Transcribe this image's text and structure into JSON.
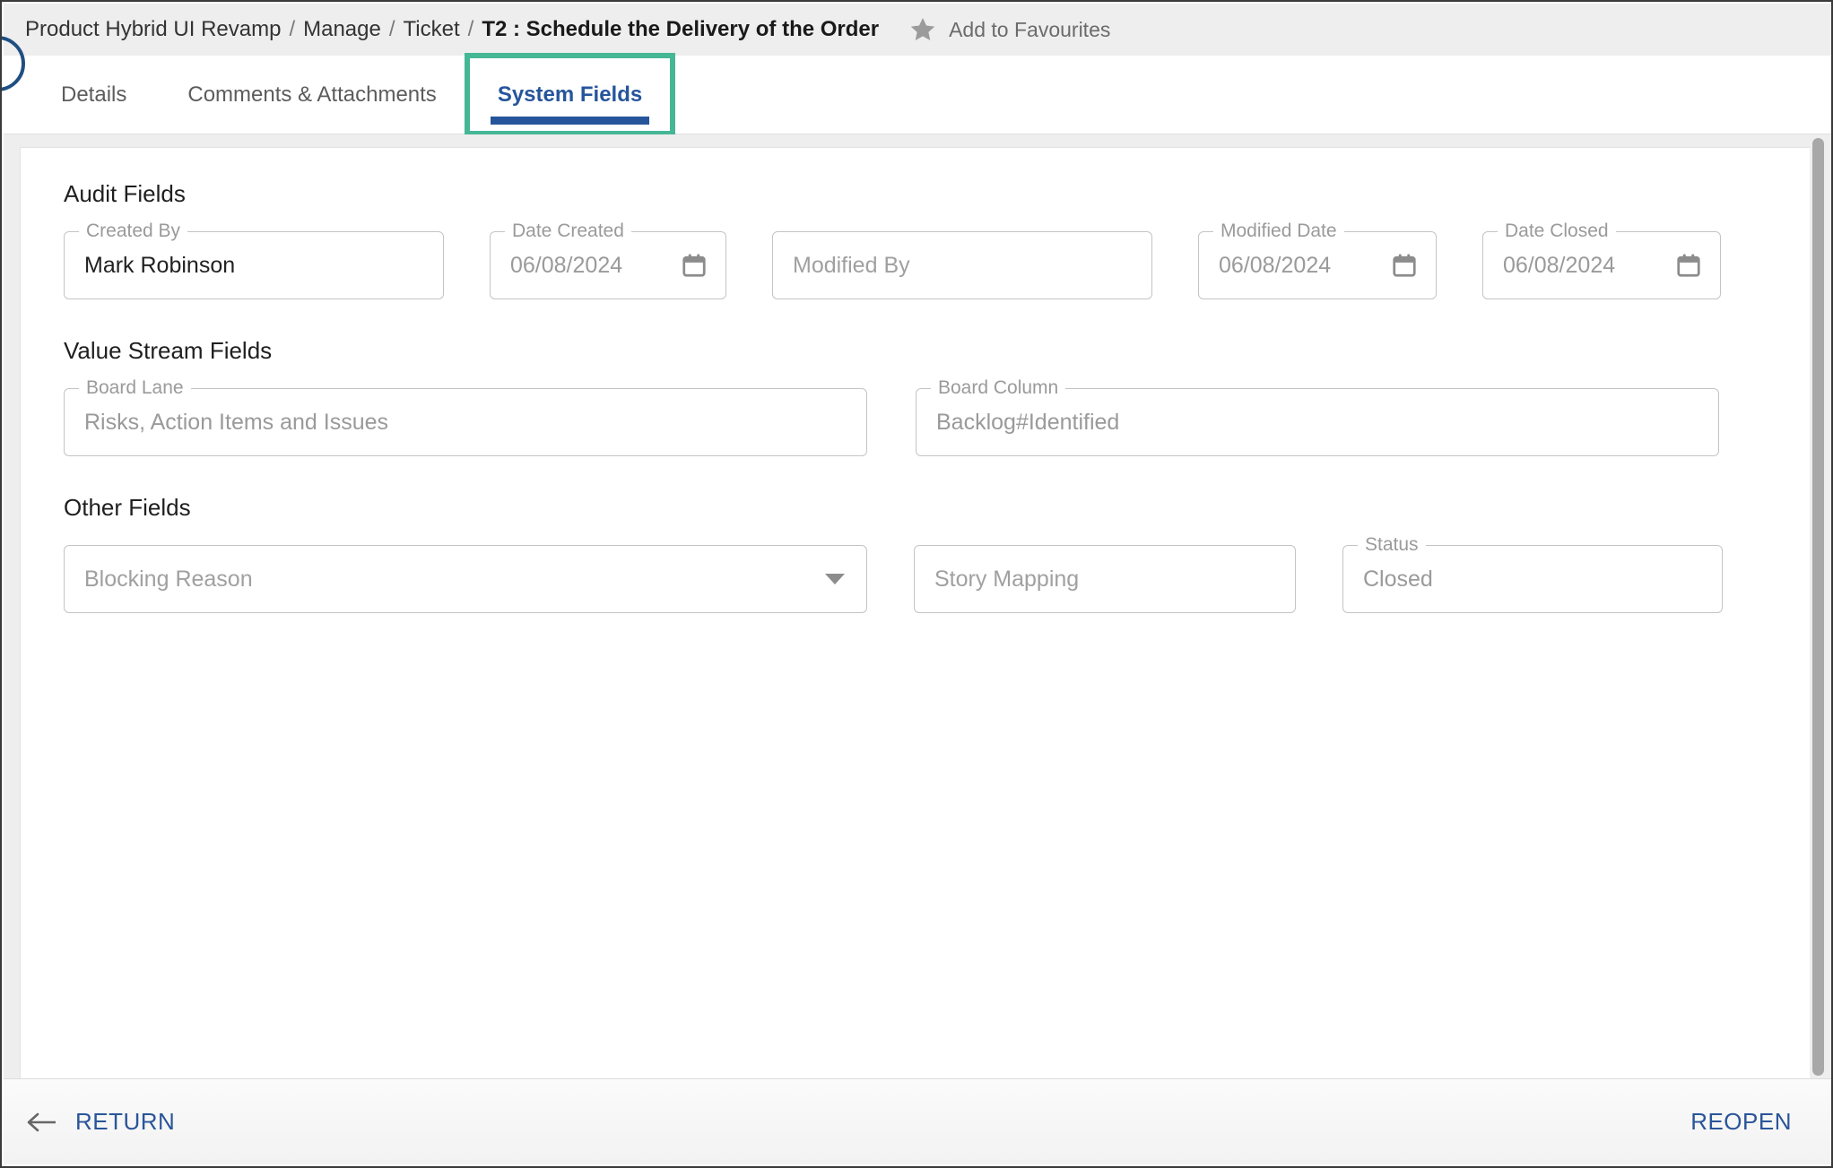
{
  "breadcrumb": {
    "items": [
      "Product Hybrid UI Revamp",
      "Manage",
      "Ticket"
    ],
    "separator": "/",
    "current": "T2 : Schedule the Delivery of the Order",
    "favourite_label": "Add to Favourites",
    "star_icon": "star-icon"
  },
  "tabs": [
    {
      "label": "Details",
      "active": false
    },
    {
      "label": "Comments & Attachments",
      "active": false
    },
    {
      "label": "System Fields",
      "active": true,
      "highlighted": true
    }
  ],
  "sections": [
    {
      "title": "Audit Fields",
      "fields": [
        {
          "name": "created-by",
          "label": "Created By",
          "value": "Mark Robinson",
          "kind": "text",
          "muted": false,
          "width_class": "w-created-by"
        },
        {
          "name": "date-created",
          "label": "Date Created",
          "value": "06/08/2024",
          "kind": "date",
          "muted": true,
          "width_class": "w-date-created"
        },
        {
          "name": "modified-by",
          "label": "",
          "value": "Modified By",
          "kind": "text",
          "muted": true,
          "width_class": "w-modified-by"
        },
        {
          "name": "modified-date",
          "label": "Modified Date",
          "value": "06/08/2024",
          "kind": "date",
          "muted": true,
          "width_class": "w-modified-date"
        },
        {
          "name": "date-closed",
          "label": "Date Closed",
          "value": "06/08/2024",
          "kind": "date",
          "muted": true,
          "width_class": "w-date-closed"
        }
      ]
    },
    {
      "title": "Value Stream Fields",
      "fields": [
        {
          "name": "board-lane",
          "label": "Board Lane",
          "value": "Risks, Action Items and Issues",
          "kind": "text",
          "muted": true,
          "width_class": "w-board-lane"
        },
        {
          "name": "board-column",
          "label": "Board Column",
          "value": "Backlog#Identified",
          "kind": "text",
          "muted": true,
          "width_class": "w-board-column"
        }
      ]
    },
    {
      "title": "Other Fields",
      "fields": [
        {
          "name": "blocking-reason",
          "label": "",
          "value": "Blocking Reason",
          "kind": "select",
          "muted": true,
          "width_class": "w-blocking"
        },
        {
          "name": "story-mapping",
          "label": "",
          "value": "Story Mapping",
          "kind": "text",
          "muted": true,
          "width_class": "w-story"
        },
        {
          "name": "status",
          "label": "Status",
          "value": "Closed",
          "kind": "text",
          "muted": true,
          "width_class": "w-status"
        }
      ]
    }
  ],
  "footer": {
    "return_label": "RETURN",
    "return_icon": "arrow-left-icon",
    "reopen_label": "REOPEN"
  },
  "colors": {
    "highlight_green": "#45b795",
    "tab_active_blue": "#26559b",
    "link_blue": "#2a5599",
    "breadcrumb_bg": "#eeeeee",
    "field_border": "#c4c4c4",
    "muted_text": "#9a9a9a"
  }
}
